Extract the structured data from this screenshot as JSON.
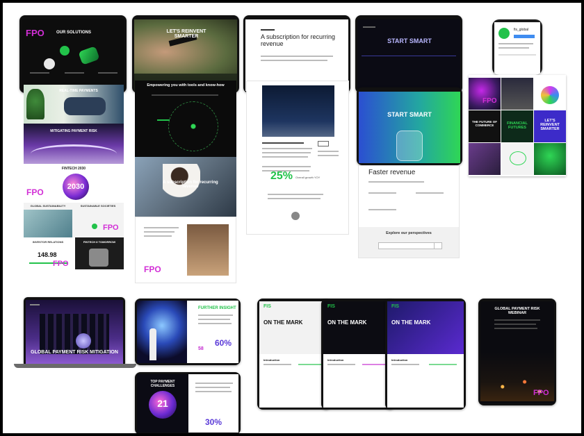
{
  "site1": {
    "fpo_top": "FPO",
    "our_solutions": "OUR SOLUTIONS",
    "realtime_payments": "REAL-TIME PAYMENTS",
    "mitigating_risk": "MITIGATING PAYMENT RISK",
    "fintech_year": "FINTECH 2030",
    "year_badge": "2030",
    "fpo_mid": "FPO",
    "global_sustainability": "GLOBAL SUSTAINABILITY",
    "sustainable_societies": "SUSTAINABLE SOCIETIES",
    "fpo_right": "FPO",
    "investor_relations": "INVESTOR RELATIONS",
    "fintech_tomorrow": "FINTECH 8 TOMORROW",
    "stock_value": "148.98",
    "fpo_bottom": "FPO"
  },
  "site2": {
    "hero": "LET'S REINVENT SMARTER",
    "empower": "Empowering you with tools and know-how",
    "overlay": "A subscription for recurring revenue",
    "fpo": "FPO"
  },
  "site3": {
    "title": "A subscription for recurring revenue",
    "stat": "25%",
    "stat_label": "Overall growth YOY"
  },
  "site4": {
    "start_smart_1": "START SMART",
    "start_smart_2": "START SMART",
    "faster_revenue": "Faster revenue",
    "explore": "Explore our perspectives"
  },
  "phone": {
    "handle": "fis_global"
  },
  "social": {
    "reinvent": "LET'S REINVENT SMARTER",
    "futures": "FINANCIAL FUTURES",
    "commerce": "THE FUTURE OF COMMERCE",
    "fpo": "FPO"
  },
  "laptop": {
    "title": "GLOBAL PAYMENT RISK MITIGATION"
  },
  "further": {
    "title": "FURTHER INSIGHT",
    "pct": "60%",
    "mini_stat": "58"
  },
  "challenges": {
    "title": "TOP PAYMENT CHALLENGES",
    "num": "21",
    "pct": "30%"
  },
  "tablets": {
    "logo": "FIS",
    "on_the_mark": "ON THE MARK",
    "intro": "Introduction"
  },
  "webinar": {
    "title": "GLOBAL PAYMENT RISK WEBINAR",
    "fpo": "FPO"
  }
}
